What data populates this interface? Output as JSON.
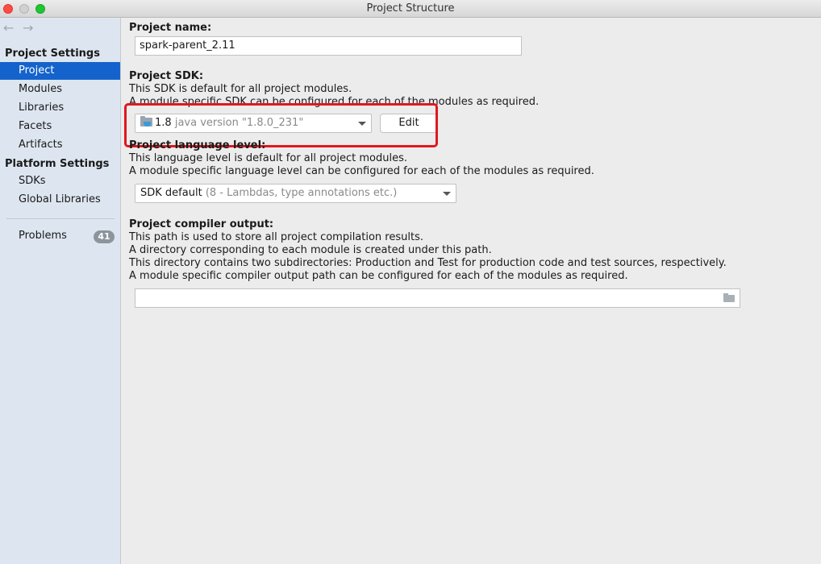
{
  "window": {
    "title": "Project Structure"
  },
  "nav": {
    "back": "←",
    "forward": "→"
  },
  "sidebar": {
    "project_settings_heading": "Project Settings",
    "project_settings_items": [
      {
        "label": "Project",
        "selected": true
      },
      {
        "label": "Modules"
      },
      {
        "label": "Libraries"
      },
      {
        "label": "Facets"
      },
      {
        "label": "Artifacts"
      }
    ],
    "platform_settings_heading": "Platform Settings",
    "platform_settings_items": [
      {
        "label": "SDKs"
      },
      {
        "label": "Global Libraries"
      }
    ],
    "problems": {
      "label": "Problems",
      "count": "41"
    }
  },
  "project_name": {
    "label": "Project name:",
    "value": "spark-parent_2.11"
  },
  "project_sdk": {
    "label": "Project SDK:",
    "desc1": "This SDK is default for all project modules.",
    "desc2": "A module specific SDK can be configured for each of the modules as required.",
    "selected_version": "1.8",
    "selected_detail": "java version \"1.8.0_231\"",
    "edit_label": "Edit",
    "highlight_color": "#e0181e"
  },
  "language_level": {
    "label": "Project language level:",
    "desc1": "This language level is default for all project modules.",
    "desc2": "A module specific language level can be configured for each of the modules as required.",
    "selected_value": "SDK default",
    "selected_detail": "(8 - Lambdas, type annotations etc.)"
  },
  "compiler_output": {
    "label": "Project compiler output:",
    "desc1": "This path is used to store all project compilation results.",
    "desc2": "A directory corresponding to each module is created under this path.",
    "desc3": "This directory contains two subdirectories: Production and Test for production code and test sources, respectively.",
    "desc4": "A module specific compiler output path can be configured for each of the modules as required.",
    "value": ""
  },
  "colors": {
    "selection": "#1463cc",
    "sidebar_bg": "#dde6f0",
    "content_bg": "#ececec"
  }
}
